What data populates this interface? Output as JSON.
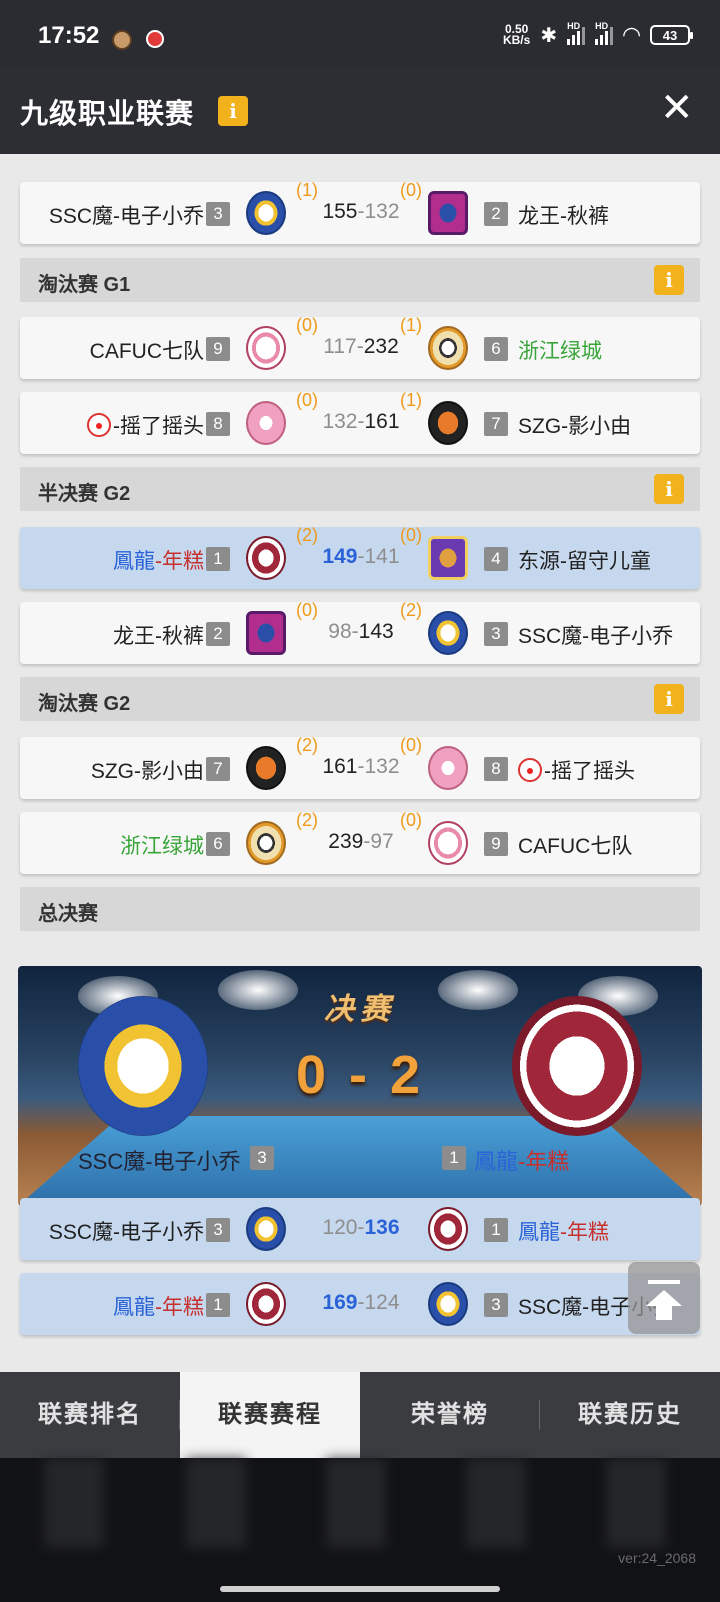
{
  "status": {
    "time": "17:52",
    "speed_top": "0.50",
    "speed_bottom": "KB/s",
    "hd1": "HD",
    "hd2": "HD",
    "battery": "43"
  },
  "header": {
    "title": "九级职业联赛",
    "info": "i"
  },
  "rows": [
    {
      "left": {
        "name": "SSC魔-电子小乔",
        "seed": "3"
      },
      "right": {
        "name": "龙王-秋裤",
        "seed": "2"
      },
      "wins": [
        "(1)",
        "(0)"
      ],
      "score": [
        "155",
        "132"
      ]
    },
    {
      "left": {
        "name": "CAFUC七队",
        "seed": "9"
      },
      "right": {
        "name": "浙江绿城",
        "seed": "6"
      },
      "wins": [
        "(0)",
        "(1)"
      ],
      "score": [
        "117",
        "232"
      ]
    },
    {
      "left": {
        "name": "-摇了摇头",
        "seed": "8"
      },
      "right": {
        "name": "SZG-影小由",
        "seed": "7"
      },
      "wins": [
        "(0)",
        "(1)"
      ],
      "score": [
        "132",
        "161"
      ]
    },
    {
      "left": {
        "name_a": "鳳龍",
        "name_b": "-年糕",
        "seed": "1"
      },
      "right": {
        "name": "东源-留守儿童",
        "seed": "4"
      },
      "wins": [
        "(2)",
        "(0)"
      ],
      "score": [
        "149",
        "141"
      ]
    },
    {
      "left": {
        "name": "龙王-秋裤",
        "seed": "2"
      },
      "right": {
        "name": "SSC魔-电子小乔",
        "seed": "3"
      },
      "wins": [
        "(0)",
        "(2)"
      ],
      "score": [
        "98",
        "143"
      ]
    },
    {
      "left": {
        "name": "SZG-影小由",
        "seed": "7"
      },
      "right": {
        "name": "-摇了摇头",
        "seed": "8"
      },
      "wins": [
        "(2)",
        "(0)"
      ],
      "score": [
        "161",
        "132"
      ]
    },
    {
      "left": {
        "name": "浙江绿城",
        "seed": "6"
      },
      "right": {
        "name": "CAFUC七队",
        "seed": "9"
      },
      "wins": [
        "(2)",
        "(0)"
      ],
      "score": [
        "239",
        "97"
      ]
    },
    {
      "left": {
        "name": "SSC魔-电子小乔",
        "seed": "3"
      },
      "right": {
        "name_a": "鳳龍",
        "name_b": "-年糕",
        "seed": "1"
      },
      "score": [
        "120",
        "136"
      ]
    },
    {
      "left": {
        "name_a": "鳳龍",
        "name_b": "-年糕",
        "seed": "1"
      },
      "right": {
        "name": "SSC魔-电子小乔",
        "seed": "3"
      },
      "score": [
        "169",
        "124"
      ]
    }
  ],
  "sections": [
    "淘汰赛 G1",
    "半决赛 G2",
    "淘汰赛 G2",
    "总决赛"
  ],
  "final": {
    "title": "决赛",
    "score": "0 - 2",
    "left_name": "SSC魔-电子小乔",
    "left_seed": "3",
    "right_seed": "1",
    "right_name_a": "鳳龍",
    "right_name_b": "-年糕"
  },
  "tabs": [
    "联赛排名",
    "联赛赛程",
    "荣誉榜",
    "联赛历史"
  ],
  "version": "ver:24_2068",
  "colors": {
    "accent_orange": "#f2b21c",
    "win_blue": "#2a62d8",
    "name_red": "#c6302c",
    "team_green": "#3aa53a",
    "wins_orange": "#ef9a1a",
    "highlight_row": "#c6d8ee"
  }
}
